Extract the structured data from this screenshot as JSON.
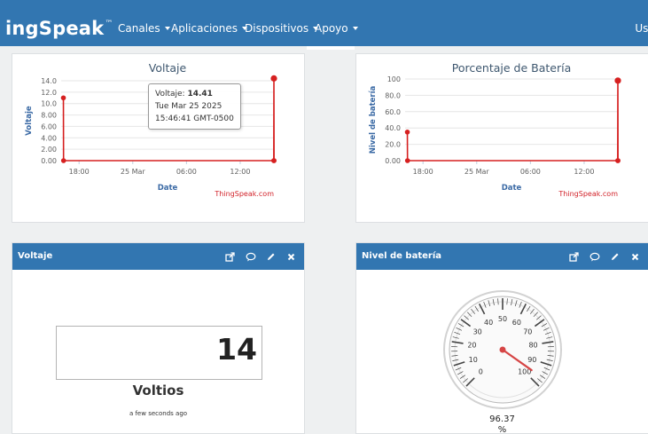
{
  "nav": {
    "brand": "ingSpeak",
    "brand_mark": "™",
    "items": [
      "Canales",
      "Aplicaciones",
      "Dispositivos",
      "Apoyo"
    ],
    "right_label": "Usu"
  },
  "charts": [
    {
      "title": "Voltaje",
      "xlabel": "Date",
      "ylabel": "Voltaje",
      "credit": "ThingSpeak.com",
      "y_ticks": [
        "0.00",
        "2.00",
        "4.00",
        "6.00",
        "8.00",
        "10.0",
        "12.0",
        "14.0"
      ],
      "x_ticks": [
        "18:00",
        "25 Mar",
        "06:00",
        "12:00"
      ],
      "tooltip": {
        "label": "Voltaje:",
        "value": "14.41",
        "date": "Tue Mar 25 2025",
        "time": "15:46:41 GMT-0500"
      }
    },
    {
      "title": "Porcentaje de Batería",
      "xlabel": "Date",
      "ylabel": "Nivel de batería",
      "credit": "ThingSpeak.com",
      "y_ticks": [
        "0.00",
        "20.0",
        "40.0",
        "60.0",
        "80.0",
        "100"
      ],
      "x_ticks": [
        "18:00",
        "25 Mar",
        "06:00",
        "12:00"
      ]
    }
  ],
  "chart_data": [
    {
      "type": "line",
      "title": "Voltaje",
      "xlabel": "Date",
      "ylabel": "Voltaje",
      "ylim": [
        0,
        14
      ],
      "x_ticks": [
        "18:00",
        "25 Mar",
        "06:00",
        "12:00"
      ],
      "points": [
        {
          "x": "Mar 24 16:15",
          "y": 11.0
        },
        {
          "x": "Mar 24 16:16",
          "y": 0.0
        },
        {
          "x": "Mar 25 15:45",
          "y": 0.0
        },
        {
          "x": "Mar 25 15:46:41",
          "y": 14.41
        },
        {
          "x": "Mar 25 15:47",
          "y": 0.0
        }
      ],
      "color": "#d62020"
    },
    {
      "type": "line",
      "title": "Porcentaje de Batería",
      "xlabel": "Date",
      "ylabel": "Nivel de batería",
      "ylim": [
        0,
        100
      ],
      "x_ticks": [
        "18:00",
        "25 Mar",
        "06:00",
        "12:00"
      ],
      "points": [
        {
          "x": "Mar 24 16:15",
          "y": 35
        },
        {
          "x": "Mar 24 16:16",
          "y": 0
        },
        {
          "x": "Mar 25 15:45",
          "y": 0
        },
        {
          "x": "Mar 25 15:46",
          "y": 98
        },
        {
          "x": "Mar 25 15:47",
          "y": 0
        }
      ],
      "color": "#d62020"
    }
  ],
  "widgets": {
    "voltage": {
      "title": "Voltaje",
      "value": "14",
      "units": "Voltios",
      "updated": "a few seconds ago"
    },
    "battery": {
      "title": "Nivel de batería",
      "value": "96.37",
      "unit": "%",
      "gauge_min": 0,
      "gauge_max": 100,
      "gauge_value": 96.37,
      "scale_labels": [
        "0",
        "10",
        "20",
        "30",
        "40",
        "50",
        "60",
        "70",
        "80",
        "90",
        "100"
      ]
    }
  },
  "icons": {
    "tools": [
      "external-link-icon",
      "comment-icon",
      "pencil-icon",
      "close-icon"
    ]
  },
  "colors": {
    "nav_blue": "#3276b1",
    "series_red": "#d62020",
    "credit_red": "#d2232a"
  }
}
